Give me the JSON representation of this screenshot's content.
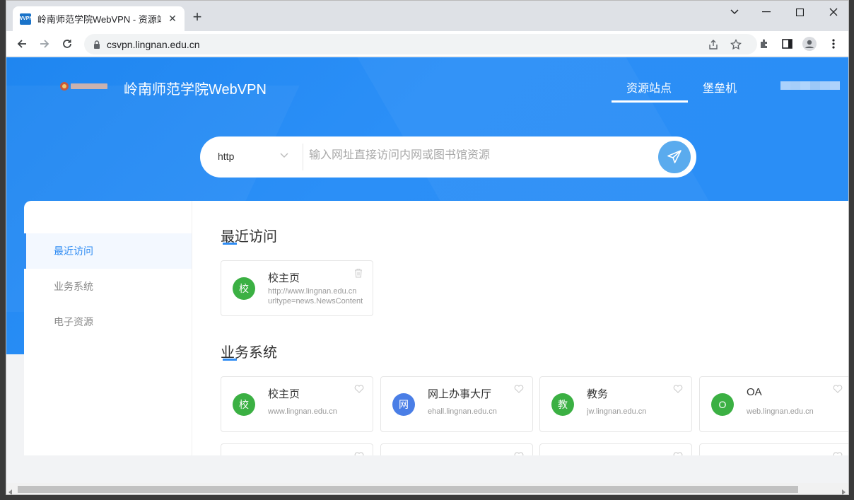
{
  "browser": {
    "tab_title": "岭南师范学院WebVPN - 资源站点",
    "favicon_text": "WVPN",
    "url": "csvpn.lingnan.edu.cn"
  },
  "site": {
    "title": "岭南师范学院WebVPN",
    "nav": [
      "资源站点",
      "堡垒机"
    ]
  },
  "search": {
    "scheme": "http",
    "placeholder": "输入网址直接访问内网或图书馆资源"
  },
  "sidebar": {
    "items": [
      {
        "label": "最近访问",
        "active": true
      },
      {
        "label": "业务系统",
        "active": false
      },
      {
        "label": "电子资源",
        "active": false
      }
    ]
  },
  "recent": {
    "title": "最近访问",
    "cards": [
      {
        "badge": "校",
        "name": "校主页",
        "url_line1": "http://www.lingnan.edu.cn",
        "url_line2": "urltype=news.NewsContent",
        "color": "#3bb043"
      }
    ]
  },
  "business": {
    "title": "业务系统",
    "cards": [
      {
        "badge": "校",
        "name": "校主页",
        "url": "www.lingnan.edu.cn",
        "color": "#3bb043"
      },
      {
        "badge": "网",
        "name": "网上办事大厅",
        "url": "ehall.lingnan.edu.cn",
        "color": "#4a7ee6"
      },
      {
        "badge": "教",
        "name": "教务",
        "url": "jw.lingnan.edu.cn",
        "color": "#3bb043"
      },
      {
        "badge": "O",
        "name": "OA",
        "url": "web.lingnan.edu.cn",
        "color": "#3bb043"
      }
    ]
  },
  "colors": {
    "accent": "#2f8cf3",
    "hero": "#2a8df5"
  }
}
